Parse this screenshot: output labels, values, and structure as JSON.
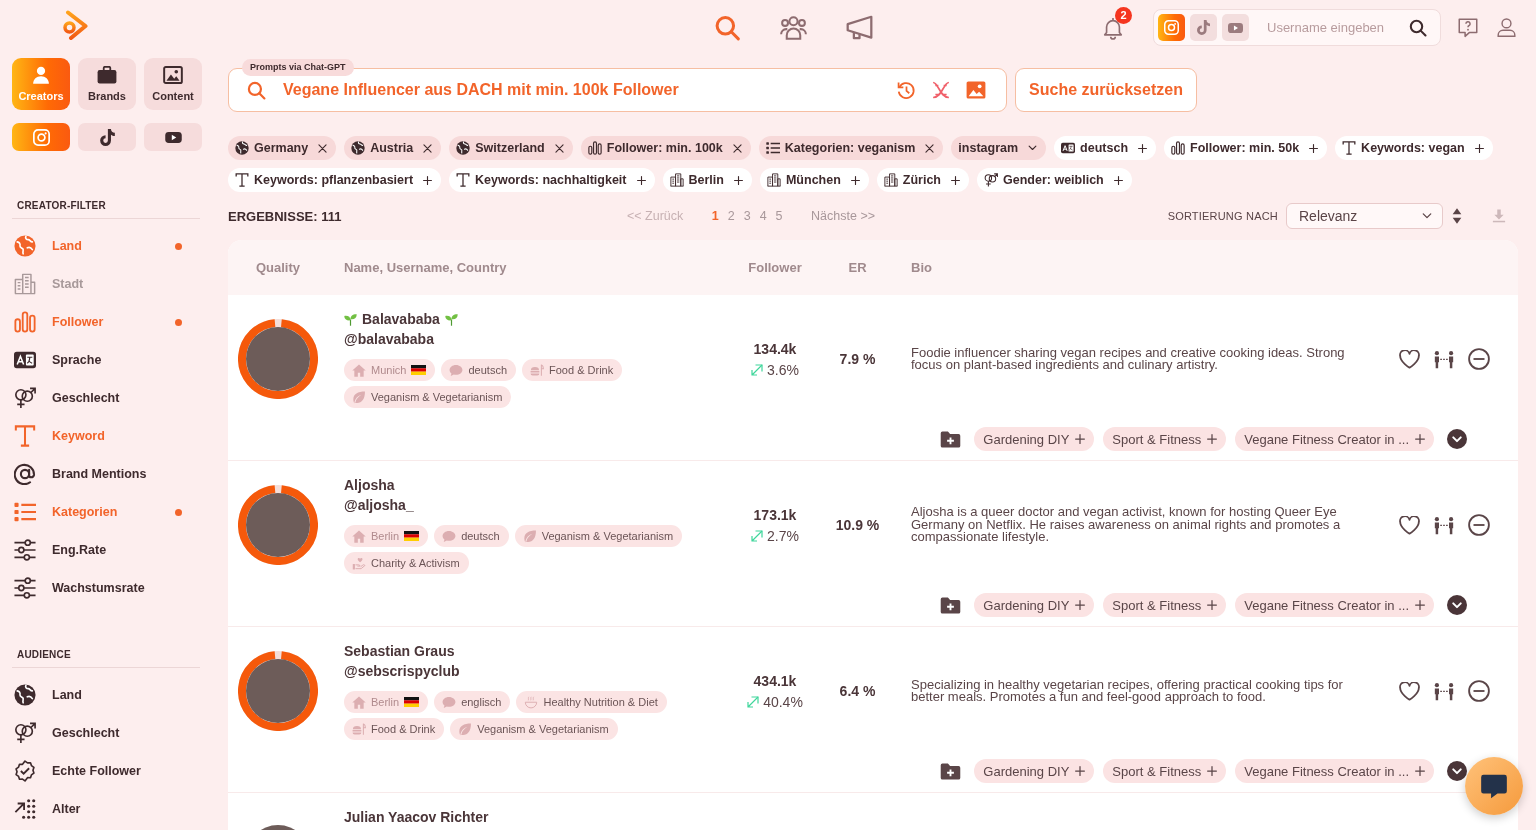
{
  "sidebar": {
    "mode_tabs": [
      {
        "label": "Creators",
        "kind": "creators",
        "selected": true
      },
      {
        "label": "Brands",
        "kind": "brands",
        "selected": false
      },
      {
        "label": "Content",
        "kind": "content",
        "selected": false
      }
    ],
    "platform_tabs": [
      {
        "kind": "instagram",
        "selected": true
      },
      {
        "kind": "tiktok",
        "selected": false
      },
      {
        "kind": "youtube",
        "selected": false
      }
    ],
    "sections": [
      {
        "title": "CREATOR-FILTER",
        "items": [
          {
            "label": "Land",
            "kind": "country",
            "active": true,
            "applied": true,
            "disabled": false
          },
          {
            "label": "Stadt",
            "kind": "city",
            "active": false,
            "applied": false,
            "disabled": true
          },
          {
            "label": "Follower",
            "kind": "followers",
            "active": true,
            "applied": true,
            "disabled": false
          },
          {
            "label": "Sprache",
            "kind": "language",
            "active": false,
            "applied": false,
            "disabled": false
          },
          {
            "label": "Geschlecht",
            "kind": "gender",
            "active": false,
            "applied": false,
            "disabled": false
          },
          {
            "label": "Keyword",
            "kind": "keyword",
            "active": true,
            "applied": false,
            "disabled": false
          },
          {
            "label": "Brand Mentions",
            "kind": "mentions",
            "active": false,
            "applied": false,
            "disabled": false
          },
          {
            "label": "Kategorien",
            "kind": "category",
            "active": true,
            "applied": true,
            "disabled": false
          },
          {
            "label": "Eng.Rate",
            "kind": "engagement",
            "active": false,
            "applied": false,
            "disabled": false
          },
          {
            "label": "Wachstumsrate",
            "kind": "growth",
            "active": false,
            "applied": false,
            "disabled": false
          }
        ]
      },
      {
        "title": "AUDIENCE",
        "items": [
          {
            "label": "Land",
            "kind": "country",
            "active": false,
            "applied": false,
            "disabled": false
          },
          {
            "label": "Geschlecht",
            "kind": "gender",
            "active": false,
            "applied": false,
            "disabled": false
          },
          {
            "label": "Echte Follower",
            "kind": "verified",
            "active": false,
            "applied": false,
            "disabled": false
          },
          {
            "label": "Alter",
            "kind": "age",
            "active": false,
            "applied": false,
            "disabled": false
          }
        ]
      }
    ]
  },
  "top_nav": [
    {
      "kind": "search",
      "selected": true
    },
    {
      "kind": "network",
      "selected": false
    },
    {
      "kind": "campaigns",
      "selected": false
    }
  ],
  "notifications": {
    "count": "2"
  },
  "username_search": {
    "platforms": [
      {
        "kind": "instagram",
        "selected": true
      },
      {
        "kind": "tiktok",
        "selected": false
      },
      {
        "kind": "youtube",
        "selected": false
      }
    ],
    "placeholder": "Username eingeben"
  },
  "prompt_search": {
    "label": "Prompts via Chat-GPT",
    "value": "Vegane Influencer aus DACH mit min. 100k Follower"
  },
  "reset_button": {
    "label": "Suche zurücksetzen"
  },
  "filter_chips": [
    {
      "label": "Germany",
      "kind": "country",
      "applied": true
    },
    {
      "label": "Austria",
      "kind": "country",
      "applied": true
    },
    {
      "label": "Switzerland",
      "kind": "country",
      "applied": true
    },
    {
      "label": "Follower: min. 100k",
      "kind": "followers",
      "applied": true
    },
    {
      "label": "Kategorien: veganism",
      "kind": "category",
      "applied": true
    },
    {
      "label": "instagram",
      "kind": "platform",
      "applied": true
    },
    {
      "label": "deutsch",
      "kind": "language",
      "applied": false
    },
    {
      "label": "Follower: min. 50k",
      "kind": "followers",
      "applied": false
    },
    {
      "label": "Keywords: vegan",
      "kind": "keyword",
      "applied": false
    },
    {
      "label": "Keywords: pflanzenbasiert",
      "kind": "keyword",
      "applied": false
    },
    {
      "label": "Keywords: nachhaltigkeit",
      "kind": "keyword",
      "applied": false
    },
    {
      "label": "Berlin",
      "kind": "city",
      "applied": false
    },
    {
      "label": "München",
      "kind": "city",
      "applied": false
    },
    {
      "label": "Zürich",
      "kind": "city",
      "applied": false
    },
    {
      "label": "Gender: weiblich",
      "kind": "gender",
      "applied": false
    }
  ],
  "results": {
    "label": "ERGEBNISSE: 111"
  },
  "pagination": {
    "previous": {
      "label": "<< Zurück",
      "disabled": true
    },
    "pages": [
      {
        "label": "1",
        "selected": true
      },
      {
        "label": "2",
        "selected": false
      },
      {
        "label": "3",
        "selected": false
      },
      {
        "label": "4",
        "selected": false
      },
      {
        "label": "5",
        "selected": false
      }
    ],
    "next": {
      "label": "Nächste >>",
      "disabled": false
    }
  },
  "sort": {
    "label": "SORTIERUNG NACH",
    "value": "Relevanz"
  },
  "table": {
    "columns": [
      "Quality",
      "Name, Username, Country",
      "Follower",
      "ER",
      "Bio"
    ],
    "rows": [
      {
        "name": "Balavababa",
        "sprouts": true,
        "username": "@balavababa",
        "quality": {
          "level": 0.97
        },
        "tags": [
          {
            "label": "Munich",
            "kind": "location"
          },
          {
            "label": "deutsch",
            "kind": "language"
          },
          {
            "label": "Food & Drink",
            "kind": "food"
          },
          {
            "label": "Veganism & Vegetarianism",
            "kind": "vegan"
          }
        ],
        "followers": "134.4k",
        "growth": "3.6%",
        "er": "7.9 %",
        "bio": "Foodie influencer sharing vegan recipes and creative cooking ideas. Strong focus on plant-based ingredients and culinary artistry.",
        "lists": [
          "Gardening DIY",
          "Sport & Fitness",
          "Vegane Fitness Creator in ..."
        ]
      },
      {
        "name": "Aljosha",
        "sprouts": false,
        "username": "@aljosha_",
        "quality": {
          "level": 0.97
        },
        "tags": [
          {
            "label": "Berlin",
            "kind": "location"
          },
          {
            "label": "deutsch",
            "kind": "language"
          },
          {
            "label": "Veganism & Vegetarianism",
            "kind": "vegan"
          },
          {
            "label": "Charity & Activism",
            "kind": "charity"
          }
        ],
        "followers": "173.1k",
        "growth": "2.7%",
        "er": "10.9 %",
        "bio": "Aljosha is a queer doctor and vegan activist, known for hosting Queer Eye Germany on Netflix. He raises awareness on animal rights and promotes a compassionate lifestyle.",
        "lists": [
          "Gardening DIY",
          "Sport & Fitness",
          "Vegane Fitness Creator in ..."
        ]
      },
      {
        "name": "Sebastian Graus",
        "sprouts": false,
        "username": "@sebscrispyclub",
        "quality": {
          "level": 0.97
        },
        "tags": [
          {
            "label": "Berlin",
            "kind": "location"
          },
          {
            "label": "englisch",
            "kind": "language"
          },
          {
            "label": "Healthy Nutrition & Diet",
            "kind": "nutrition"
          },
          {
            "label": "Food & Drink",
            "kind": "food"
          },
          {
            "label": "Veganism & Vegetarianism",
            "kind": "vegan"
          }
        ],
        "followers": "434.1k",
        "growth": "40.4%",
        "er": "6.4 %",
        "bio": "Specializing in healthy vegetarian recipes, offering practical cooking tips for better meals. Promotes a fun and feel-good approach to food.",
        "lists": [
          "Gardening DIY",
          "Sport & Fitness",
          "Vegane Fitness Creator in ..."
        ]
      },
      {
        "name": "Julian Yaacov Richter",
        "sprouts": false
      }
    ]
  }
}
